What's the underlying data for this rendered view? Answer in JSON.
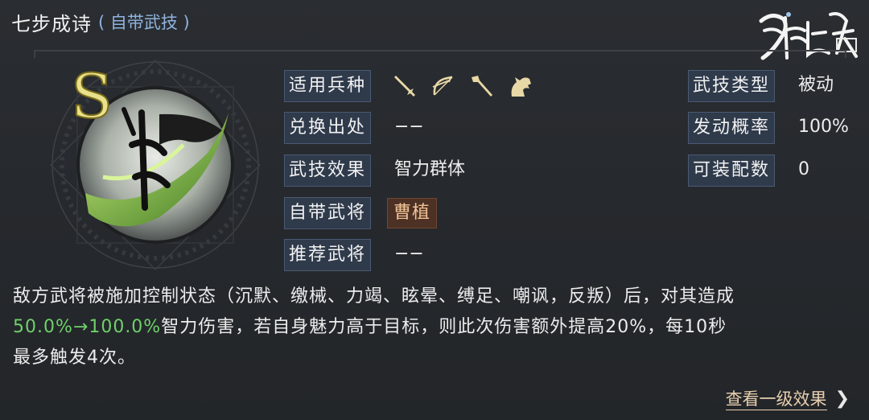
{
  "skill": {
    "name": "七步成诗",
    "tag": "( 自带武技 )",
    "grade": "S"
  },
  "logo_text": "鸿图之下",
  "fields": {
    "troop_label": "适用兵种",
    "troop_icons": [
      "sword-icon",
      "bow-icon",
      "spear-icon",
      "horse-icon"
    ],
    "source_label": "兑换出处",
    "source_value": "−−",
    "effect_label": "武技效果",
    "effect_value": "智力群体",
    "hero_label": "自带武将",
    "hero_value": "曹植",
    "recommend_label": "推荐武将",
    "recommend_value": "−−",
    "type_label": "武技类型",
    "type_value": "被动",
    "rate_label": "发动概率",
    "rate_value": "100%",
    "slots_label": "可装配数",
    "slots_value": "0"
  },
  "description": {
    "line1": "敌方武将被施加控制状态（沉默、缴械、力竭、眩晕、缚足、嘲讽，反叛）后，对其造成",
    "highlight": "50.0%→100.0%",
    "line2_rest": "智力伤害，若自身魅力高于目标，则此次伤害额外提高20%，每10秒",
    "line3": "最多触发4次。"
  },
  "more_link": "查看一级效果",
  "colors": {
    "label_bg": "#2f3a4b",
    "highlight": "#6fd06a",
    "hero_badge": "#4d3124",
    "link": "#e8cfae",
    "subtitle": "#8fb3de"
  }
}
